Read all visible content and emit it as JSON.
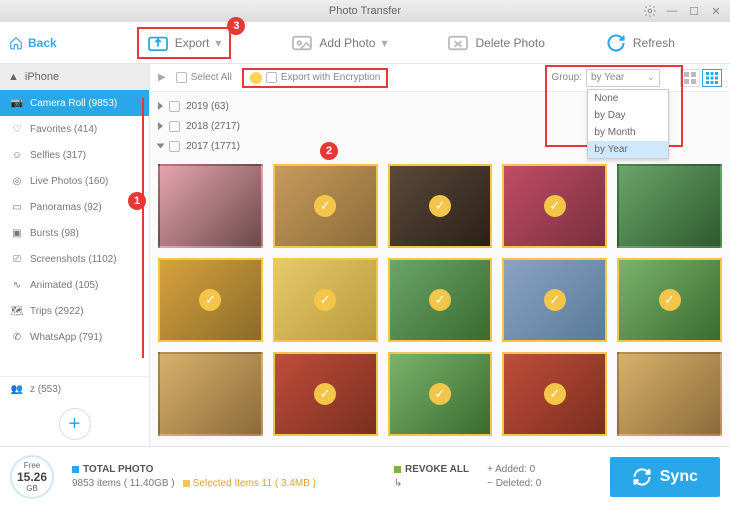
{
  "window": {
    "title": "Photo Transfer"
  },
  "back": {
    "label": "Back"
  },
  "toolbar": {
    "export": "Export",
    "addphoto": "Add Photo",
    "deletephoto": "Delete Photo",
    "refresh": "Refresh"
  },
  "badges": {
    "b1": "1",
    "b2": "2",
    "b3": "3"
  },
  "device": {
    "name": "iPhone"
  },
  "albums": [
    {
      "label": "Camera Roll (9853)",
      "icon": "camera-icon",
      "active": true
    },
    {
      "label": "Favorites (414)",
      "icon": "heart-icon"
    },
    {
      "label": "Selfies (317)",
      "icon": "person-icon"
    },
    {
      "label": "Live Photos (160)",
      "icon": "live-icon"
    },
    {
      "label": "Panoramas (92)",
      "icon": "pano-icon"
    },
    {
      "label": "Bursts (98)",
      "icon": "burst-icon"
    },
    {
      "label": "Screenshots (1102)",
      "icon": "screenshot-icon"
    },
    {
      "label": "Animated (105)",
      "icon": "animated-icon"
    },
    {
      "label": "Trips (2922)",
      "icon": "trips-icon"
    },
    {
      "label": "WhatsApp (791)",
      "icon": "whatsapp-icon"
    }
  ],
  "shared": {
    "label": "z (553)"
  },
  "subbar": {
    "selectall": "Select All",
    "encrypt": "Export with Encryption",
    "grouplabel": "Group:",
    "groupsel": "by Year",
    "options": [
      "None",
      "by Day",
      "by Month",
      "by Year"
    ]
  },
  "years": [
    {
      "label": "2019 (63)",
      "open": false
    },
    {
      "label": "2018 (2717)",
      "open": false
    },
    {
      "label": "2017 (1771)",
      "open": true
    }
  ],
  "thumbs": [
    {
      "sel": false,
      "c1": "#e6a3b0",
      "c2": "#6b4a4a"
    },
    {
      "sel": true,
      "c1": "#c89a5b",
      "c2": "#8a6b3a"
    },
    {
      "sel": true,
      "c1": "#5b4a3a",
      "c2": "#2b2018"
    },
    {
      "sel": true,
      "c1": "#c14d66",
      "c2": "#7a2f3f"
    },
    {
      "sel": false,
      "c1": "#6aa56a",
      "c2": "#2f5a2f"
    },
    {
      "sel": true,
      "c1": "#d8a23a",
      "c2": "#8a6b2a"
    },
    {
      "sel": true,
      "c1": "#e6c96a",
      "c2": "#b89a3a"
    },
    {
      "sel": true,
      "c1": "#6aa56a",
      "c2": "#3a6b2f"
    },
    {
      "sel": true,
      "c1": "#8aa3c1",
      "c2": "#5a7a99"
    },
    {
      "sel": true,
      "c1": "#7ab36a",
      "c2": "#3a6b2f"
    },
    {
      "sel": false,
      "c1": "#d8b06a",
      "c2": "#8a6b3a"
    },
    {
      "sel": true,
      "c1": "#c14d3a",
      "c2": "#7a2f1f"
    },
    {
      "sel": true,
      "c1": "#7ab36a",
      "c2": "#3a6b2f"
    },
    {
      "sel": true,
      "c1": "#c14d3a",
      "c2": "#7a2f1f"
    },
    {
      "sel": false,
      "c1": "#d8b06a",
      "c2": "#8a6b3a"
    }
  ],
  "status": {
    "free_label": "Free",
    "free_value": "15.26",
    "free_unit": "GB",
    "total_label": "TOTAL PHOTO",
    "total_line": "9853 items ( 11.40GB )",
    "selected_line": "Selected Items 11 ( 3.4MB )",
    "revoke_label": "REVOKE ALL",
    "added": "Added: 0",
    "deleted": "Deleted: 0",
    "sync": "Sync"
  }
}
